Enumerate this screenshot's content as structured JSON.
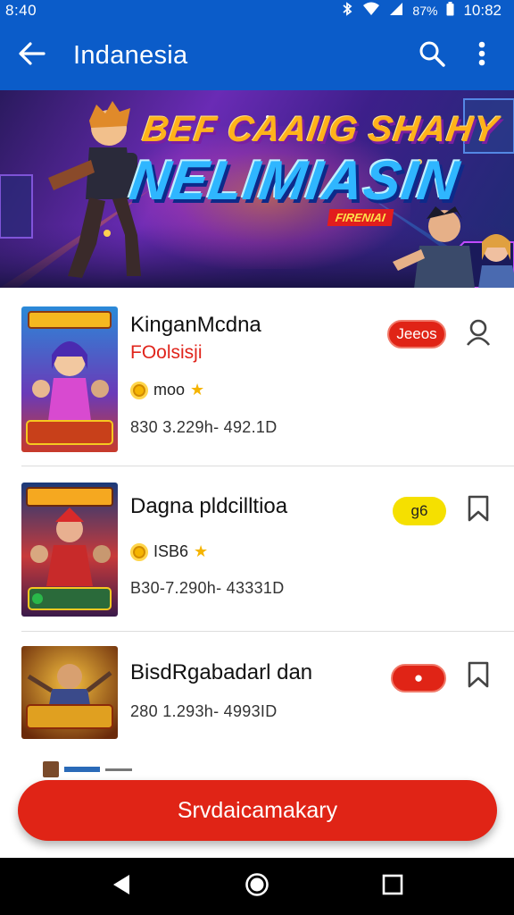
{
  "status_bar": {
    "time_left": "8:40",
    "battery": "87%",
    "time_right": "10:82"
  },
  "app_bar": {
    "title": "Indanesia",
    "back_icon": "arrow-left-icon",
    "search_icon": "search-icon",
    "more_icon": "more-vert-icon"
  },
  "banner": {
    "line1": "BEF CAAIIG SHAHY",
    "line2": "NELIMIASIN",
    "tag": "FIRENIAI"
  },
  "games": [
    {
      "title": "KinganMcdna",
      "subtitle": "FOolsisji",
      "rating_text": "moo",
      "meta": "830 3.229h- 492.1D",
      "pill_label": "Jeeos",
      "pill_color": "#e02416",
      "action_icon": "person-icon"
    },
    {
      "title": "Dagna pldcilltioa",
      "subtitle": "",
      "rating_text": "ISB6",
      "meta": "B30-7.290h- 43331D",
      "pill_label": "g6",
      "pill_color": "#f5e000",
      "action_icon": "bookmark-icon"
    },
    {
      "title": "BisdRgabadarl dan",
      "subtitle": "",
      "rating_text": "",
      "meta": "280 1.293h- 4993ID",
      "pill_label": "●",
      "pill_color": "#e02416",
      "action_icon": "bookmark-icon"
    }
  ],
  "cta": {
    "label": "Srvdaicamakary"
  },
  "nav": {
    "back_icon": "nav-back-icon",
    "home_icon": "nav-home-icon",
    "recents_icon": "nav-recents-icon"
  }
}
